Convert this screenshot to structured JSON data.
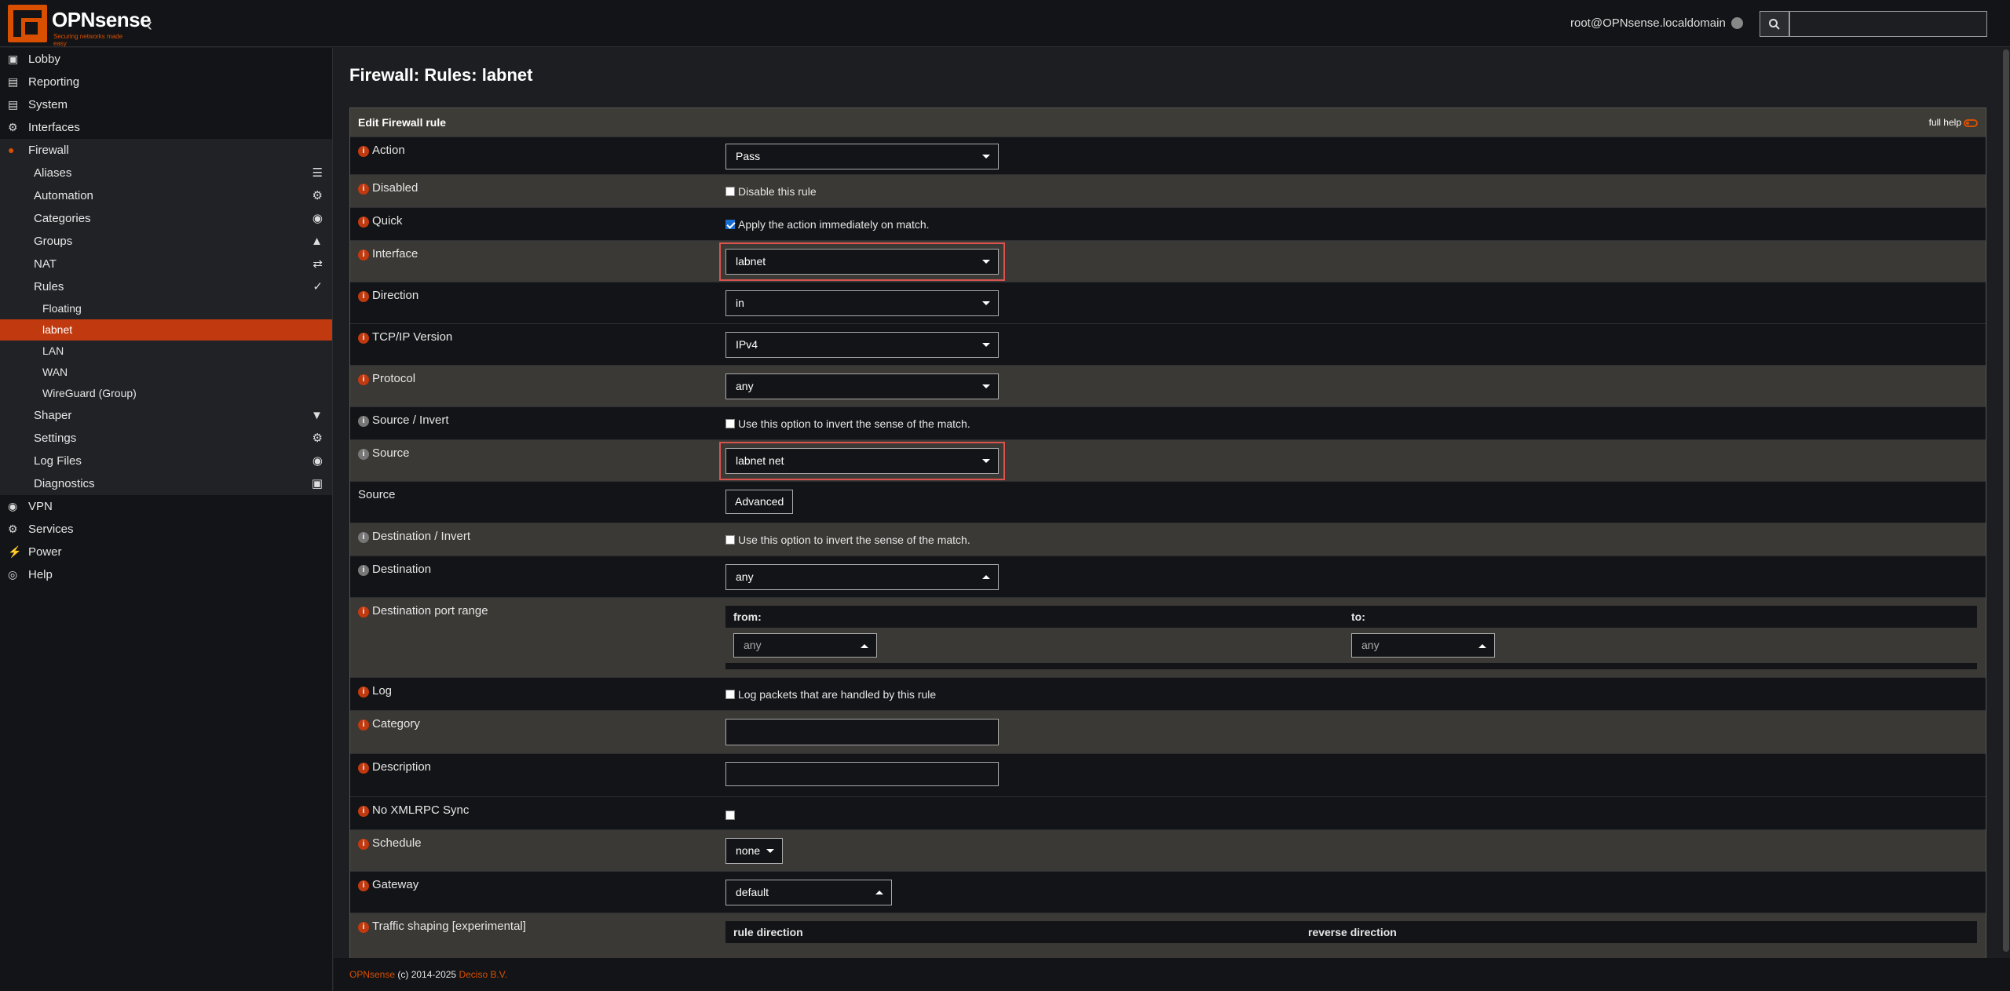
{
  "brand": {
    "name": "OPNsense",
    "tagline": "Securing networks made easy"
  },
  "header": {
    "user": "root@OPNsense.localdomain",
    "search_placeholder": ""
  },
  "sidebar": {
    "top": [
      {
        "label": "Lobby",
        "icon": "laptop-icon"
      },
      {
        "label": "Reporting",
        "icon": "chart-icon"
      },
      {
        "label": "System",
        "icon": "server-icon"
      },
      {
        "label": "Interfaces",
        "icon": "sitemap-icon"
      },
      {
        "label": "Firewall",
        "icon": "fire-icon"
      }
    ],
    "firewall": [
      {
        "label": "Aliases",
        "icon": "list-icon"
      },
      {
        "label": "Automation",
        "icon": "gear-icon"
      },
      {
        "label": "Categories",
        "icon": "tags-icon"
      },
      {
        "label": "Groups",
        "icon": "sitemap-icon"
      },
      {
        "label": "NAT",
        "icon": "exchange-icon"
      },
      {
        "label": "Rules",
        "icon": "check-icon"
      }
    ],
    "rules": [
      {
        "label": "Floating"
      },
      {
        "label": "labnet"
      },
      {
        "label": "LAN"
      },
      {
        "label": "WAN"
      },
      {
        "label": "WireGuard (Group)"
      }
    ],
    "firewall2": [
      {
        "label": "Shaper",
        "icon": "filter-icon"
      },
      {
        "label": "Settings",
        "icon": "cogs-icon"
      },
      {
        "label": "Log Files",
        "icon": "eye-icon"
      },
      {
        "label": "Diagnostics",
        "icon": "medkit-icon"
      }
    ],
    "bottom": [
      {
        "label": "VPN",
        "icon": "globe-icon"
      },
      {
        "label": "Services",
        "icon": "gear-icon"
      },
      {
        "label": "Power",
        "icon": "plug-icon"
      },
      {
        "label": "Help",
        "icon": "lifebuoy-icon"
      }
    ]
  },
  "page": {
    "title": "Firewall: Rules: labnet"
  },
  "panel": {
    "title": "Edit Firewall rule",
    "full_help": "full help"
  },
  "form": {
    "action": {
      "label": "Action",
      "value": "Pass"
    },
    "disabled": {
      "label": "Disabled",
      "text": "Disable this rule"
    },
    "quick": {
      "label": "Quick",
      "text": "Apply the action immediately on match."
    },
    "interface": {
      "label": "Interface",
      "value": "labnet"
    },
    "direction": {
      "label": "Direction",
      "value": "in"
    },
    "ipversion": {
      "label": "TCP/IP Version",
      "value": "IPv4"
    },
    "protocol": {
      "label": "Protocol",
      "value": "any"
    },
    "source_invert": {
      "label": "Source / Invert",
      "text": "Use this option to invert the sense of the match."
    },
    "source": {
      "label": "Source",
      "value": "labnet net"
    },
    "source_adv": {
      "label": "Source",
      "button": "Advanced"
    },
    "dest_invert": {
      "label": "Destination / Invert",
      "text": "Use this option to invert the sense of the match."
    },
    "destination": {
      "label": "Destination",
      "value": "any"
    },
    "dest_port": {
      "label": "Destination port range",
      "from": "from:",
      "to": "to:",
      "from_value": "any",
      "to_value": "any"
    },
    "log": {
      "label": "Log",
      "text": "Log packets that are handled by this rule"
    },
    "category": {
      "label": "Category"
    },
    "description": {
      "label": "Description"
    },
    "xmlrpc": {
      "label": "No XMLRPC Sync"
    },
    "schedule": {
      "label": "Schedule",
      "value": "none"
    },
    "gateway": {
      "label": "Gateway",
      "value": "default"
    },
    "shaping": {
      "label": "Traffic shaping [experimental]",
      "rule_direction": "rule direction",
      "reverse_direction": "reverse direction"
    }
  },
  "footer": {
    "brand": "OPNsense",
    "copyright": "(c) 2014-2025",
    "company": "Deciso B.V."
  }
}
